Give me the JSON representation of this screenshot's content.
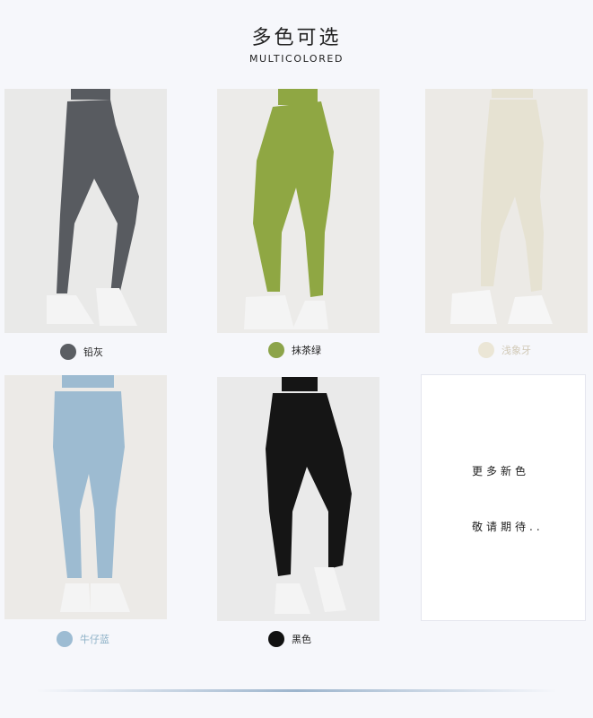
{
  "header": {
    "title": "多色可选",
    "subtitle": "MULTICOLORED"
  },
  "products": [
    {
      "color_name": "铅灰",
      "swatch_hex": "#5b5e63",
      "pant_hex": "#585b60",
      "icon": "gray-leggings-photo"
    },
    {
      "color_name": "抹茶绿",
      "swatch_hex": "#8ca44a",
      "pant_hex": "#8fa743",
      "icon": "green-leggings-photo"
    },
    {
      "color_name": "浅象牙",
      "swatch_hex": "#ebe6d6",
      "pant_hex": "#e6e2d2",
      "icon": "ivory-leggings-photo"
    },
    {
      "color_name": "牛仔蓝",
      "swatch_hex": "#9dbcd3",
      "pant_hex": "#9dbbd1",
      "icon": "blue-leggings-photo"
    },
    {
      "color_name": "黑色",
      "swatch_hex": "#111111",
      "pant_hex": "#151515",
      "icon": "black-leggings-photo"
    }
  ],
  "more_colors": {
    "line1": "更多新色",
    "line2": "敬请期待.."
  }
}
